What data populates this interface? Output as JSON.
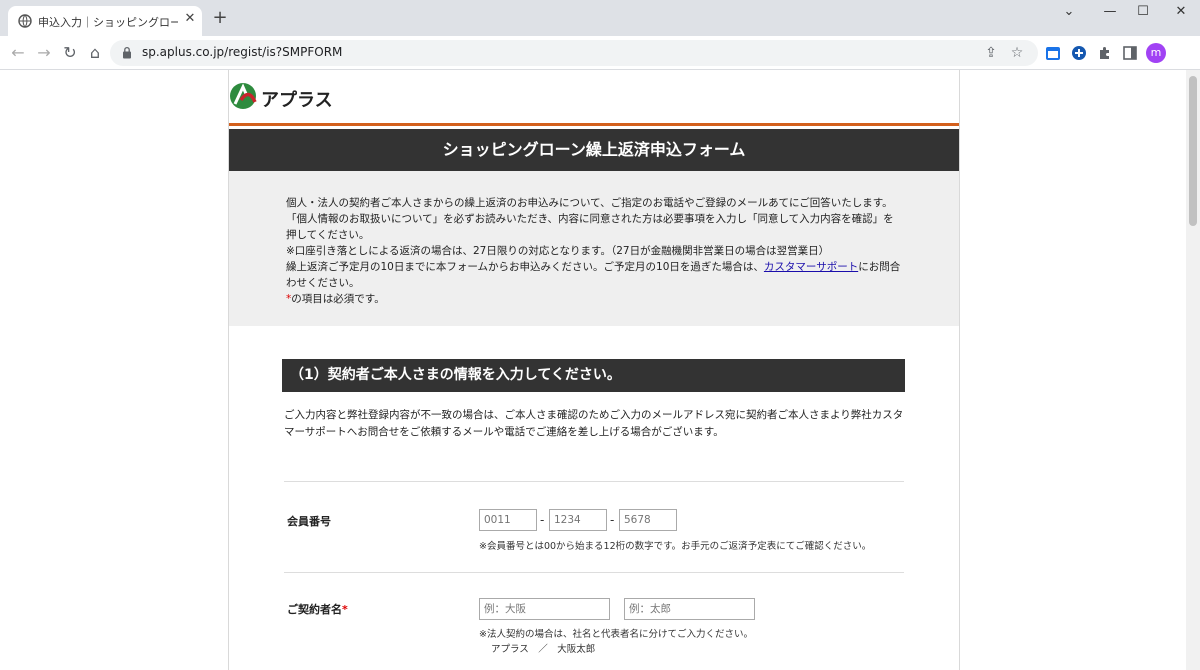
{
  "browser": {
    "tab_title": "申込入力｜ショッピングローン繰上返",
    "tab_close": "✕",
    "new_tab": "+",
    "url": "sp.aplus.co.jp/regist/is?SMPFORM",
    "avatar_letter": "m",
    "window_controls": {
      "dropdown": "⌄",
      "minimize": "—",
      "maximize": "☐",
      "close": "✕"
    },
    "nav": {
      "back": "←",
      "forward": "→",
      "reload": "↻",
      "home": "⌂"
    },
    "omni_icons": {
      "share": "⇪",
      "bookmark": "☆"
    }
  },
  "brand": {
    "name": "アプラス",
    "colors": {
      "accent": "#d3601d",
      "mark_green": "#2e8b3e",
      "mark_red": "#c8242b"
    }
  },
  "form": {
    "title": "ショッピングローン繰上返済申込フォーム",
    "notice": {
      "line1": "個人・法人の契約者ご本人さまからの繰上返済のお申込みについて、ご指定のお電話やご登録のメールあてにご回答いたします。",
      "line2": "「個人情報のお取扱いについて」を必ずお読みいただき、内容に同意された方は必要事項を入力し「同意して入力内容を確認」を押してください。",
      "line3": "※口座引き落としによる返済の場合は、27日限りの対応となります。（27日が金融機関非営業日の場合は翌営業日）",
      "line4_pre": "繰上返済ご予定月の10日までに本フォームからお申込みください。ご予定月の10日を過ぎた場合は、",
      "line4_link": "カスタマーサポート",
      "line4_post": "にお問合わせください。",
      "required_mark": "*",
      "required_text": "の項目は必須です。"
    },
    "section1": {
      "heading": "（1）契約者ご本人さまの情報を入力してください。",
      "note": "ご入力内容と弊社登録内容が不一致の場合は、ご本人さま確認のためご入力のメールアドレス宛に契約者ご本人さまより弊社カスタマーサポートへお問合せをご依頼するメールや電話でご連絡を差し上げる場合がございます。"
    },
    "member_number": {
      "label": "会員番号",
      "placeholders": [
        "0011",
        "1234",
        "5678"
      ],
      "separator": "-",
      "help": "※会員番号とは00から始まる12桁の数字です。お手元のご返済予定表にてご確認ください。"
    },
    "contract_name": {
      "label": "ご契約者名",
      "required_mark": "*",
      "placeholder_last": "例：大阪",
      "placeholder_first": "例：太郎",
      "help1": "※法人契約の場合は、社名と代表者名に分けてご入力ください。",
      "help2": "アプラス　／　大阪太郎"
    }
  }
}
